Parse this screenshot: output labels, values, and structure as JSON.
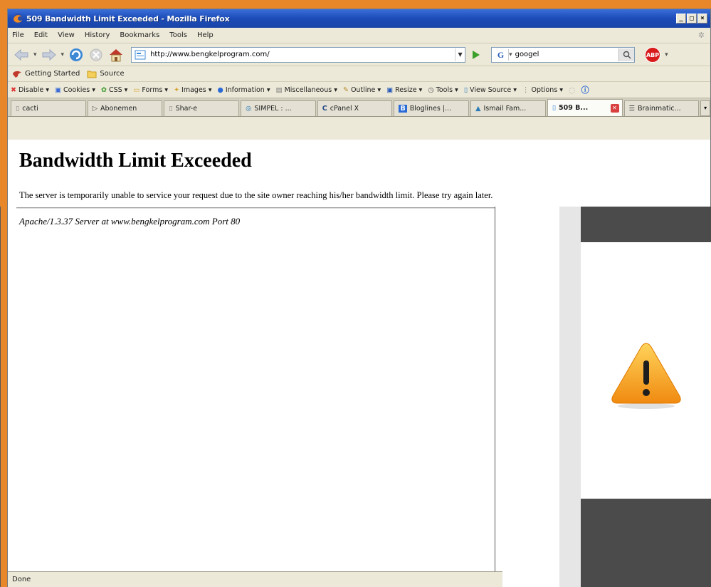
{
  "window": {
    "title": "509 Bandwidth Limit Exceeded - Mozilla Firefox",
    "controls": [
      "_",
      "□",
      "×"
    ]
  },
  "menu": [
    "File",
    "Edit",
    "View",
    "History",
    "Bookmarks",
    "Tools",
    "Help"
  ],
  "nav": {
    "url": "http://www.bengkelprogram.com/",
    "search_value": "googel"
  },
  "bookmarks": [
    "Getting Started",
    "Source"
  ],
  "webdev_toolbar": [
    "Disable",
    "Cookies",
    "CSS",
    "Forms",
    "Images",
    "Information",
    "Miscellaneous",
    "Outline",
    "Resize",
    "Tools",
    "View Source",
    "Options"
  ],
  "tabs": [
    {
      "label": "cacti"
    },
    {
      "label": "Abonemen"
    },
    {
      "label": "Shar-e"
    },
    {
      "label": "SIMPEL : ..."
    },
    {
      "label": "cPanel X"
    },
    {
      "label": "Bloglines |..."
    },
    {
      "label": "Ismail Fam..."
    },
    {
      "label": "509 B..."
    },
    {
      "label": "Brainmatic..."
    }
  ],
  "page": {
    "heading": "Bandwidth Limit Exceeded",
    "message": "The server is temporarily unable to service your request due to the site owner reaching his/her bandwidth limit. Please try again later.",
    "signature": "Apache/1.3.37 Server at www.bengkelprogram.com Port 80"
  },
  "status": {
    "text": "Done"
  },
  "colors": {
    "desktop_bg": "#e8862a",
    "titlebar": "#1c4bb8",
    "warning_orange": "#f5a51c"
  }
}
